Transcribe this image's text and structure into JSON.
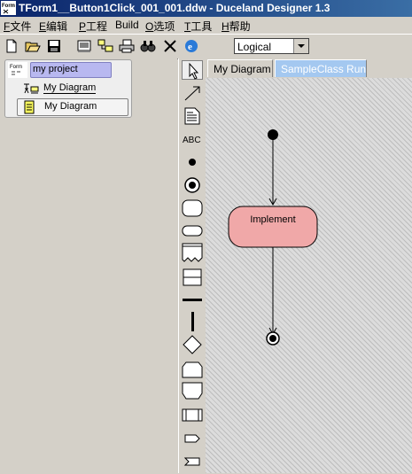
{
  "window": {
    "title": "TForm1__Button1Click_001_001.ddw - Duceland Designer 1.3",
    "app_icon_text": "Form"
  },
  "menu": [
    {
      "key": "F",
      "label": "文件"
    },
    {
      "key": "E",
      "label": "编辑"
    },
    {
      "key": "P",
      "label": "工程"
    },
    {
      "key": "",
      "label": "Build"
    },
    {
      "key": "O",
      "label": "选项"
    },
    {
      "key": "T",
      "label": "工具"
    },
    {
      "key": "H",
      "label": "帮助"
    }
  ],
  "toolbar": {
    "icons": [
      "new-file-icon",
      "open-folder-icon",
      "save-icon",
      "properties-icon",
      "hierarchy-icon",
      "print-icon",
      "find-icon",
      "close-icon",
      "browser-icon"
    ],
    "view_select": "Logical"
  },
  "project_tree": {
    "root": {
      "label": "my project",
      "icon": "form-icon"
    },
    "items": [
      {
        "label": "My Diagram",
        "icon": "diagram-icon"
      },
      {
        "label": "My Diagram",
        "icon": "document-icon"
      }
    ]
  },
  "palette": [
    "pointer-tool",
    "arrow-tool",
    "note-tool",
    "text-tool",
    "initial-node-tool",
    "final-node-tool",
    "rounded-rect-tool",
    "state-tool",
    "document-shape-tool",
    "frame-tool",
    "horizontal-bar-tool",
    "vertical-bar-tool",
    "decision-tool",
    "shape-a-tool",
    "shape-b-tool",
    "swimlane-tool",
    "send-signal-tool",
    "receive-signal-tool"
  ],
  "palette_text_label": "ABC",
  "tabs": [
    {
      "label": "My Diagram",
      "active": false
    },
    {
      "label": "SampleClass Run",
      "active": true
    }
  ],
  "diagram": {
    "action_label": "Implement",
    "action_color": "#f0a8a8"
  }
}
